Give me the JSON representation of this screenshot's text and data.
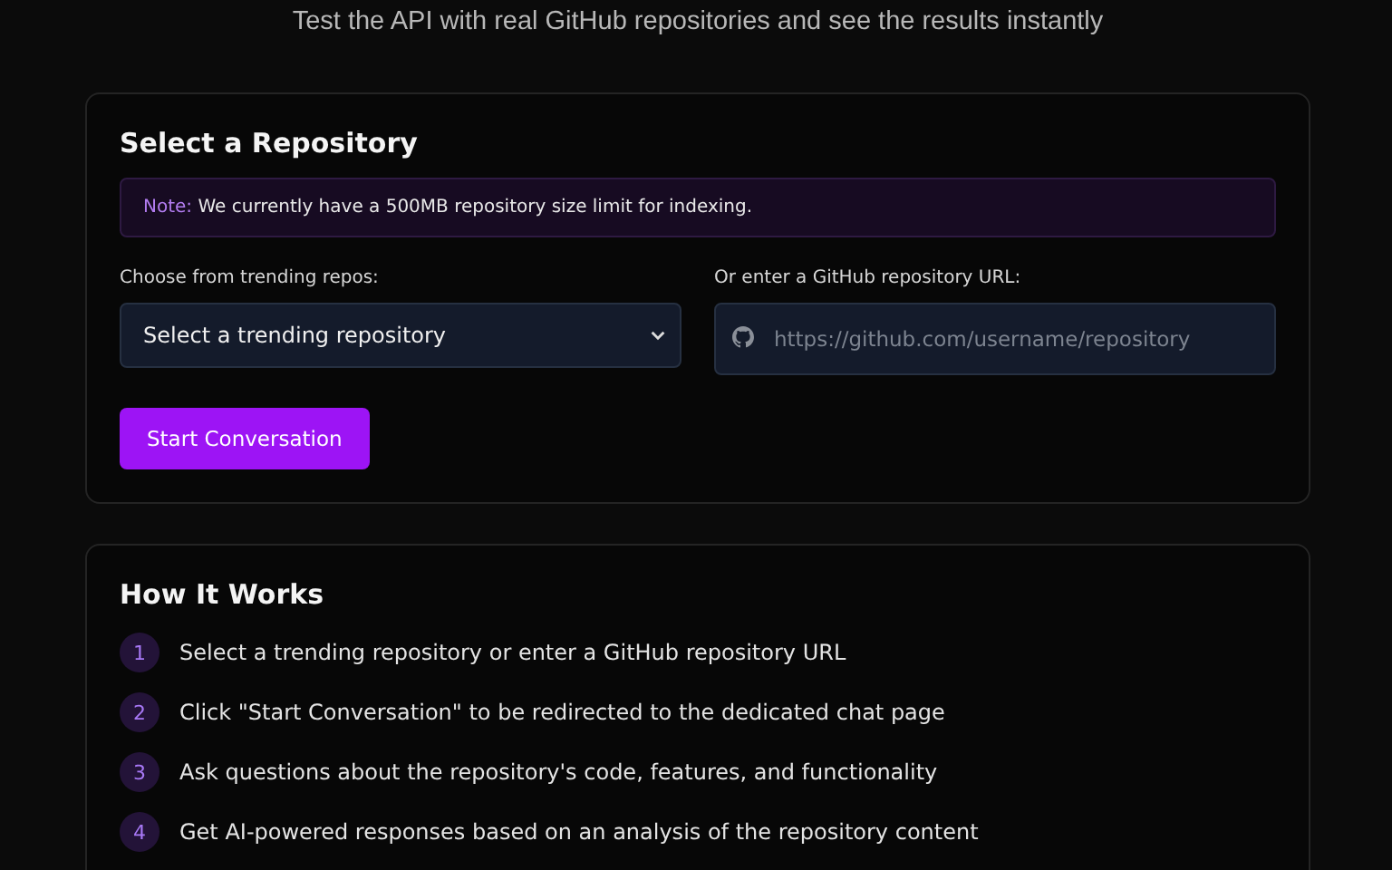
{
  "subtitle": "Test the API with real GitHub repositories and see the results instantly",
  "repo_card": {
    "title": "Select a Repository",
    "note": {
      "label": "Note:",
      "text": "We currently have a 500MB repository size limit for indexing."
    },
    "trending": {
      "label": "Choose from trending repos:",
      "value": "Select a trending repository"
    },
    "url": {
      "label": "Or enter a GitHub repository URL:",
      "placeholder": "https://github.com/username/repository"
    },
    "button": "Start Conversation"
  },
  "how_card": {
    "title": "How It Works",
    "steps": [
      {
        "number": "1",
        "text": "Select a trending repository or enter a GitHub repository URL"
      },
      {
        "number": "2",
        "text": "Click \"Start Conversation\" to be redirected to the dedicated chat page"
      },
      {
        "number": "3",
        "text": "Ask questions about the repository's code, features, and functionality"
      },
      {
        "number": "4",
        "text": "Get AI-powered responses based on an analysis of the repository content"
      }
    ]
  }
}
